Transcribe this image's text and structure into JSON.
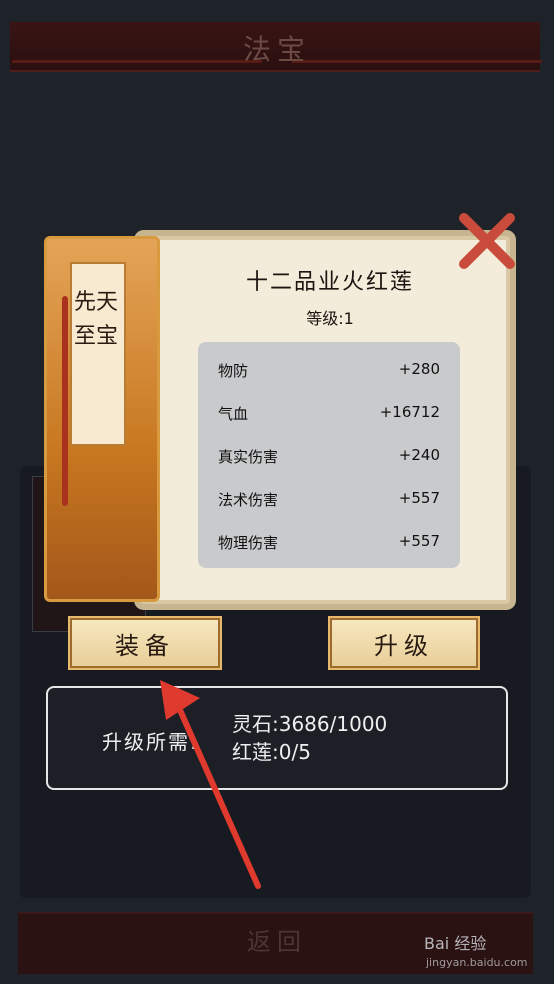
{
  "header": {
    "title": "法宝"
  },
  "footer": {
    "back_label": "返回"
  },
  "watermark": {
    "brand": "Bai 经验",
    "url": "jingyan.baidu.com"
  },
  "card": {
    "rarity_tag": "先天至宝",
    "item_name": "十二品业火红莲",
    "level_text": "等级:1",
    "stats": [
      {
        "name": "物防",
        "value": "+280"
      },
      {
        "name": "气血",
        "value": "+16712"
      },
      {
        "name": "真实伤害",
        "value": "+240"
      },
      {
        "name": "法术伤害",
        "value": "+557"
      },
      {
        "name": "物理伤害",
        "value": "+557"
      }
    ],
    "close_icon": "close-x-icon"
  },
  "buttons": {
    "equip_label": "装备",
    "upgrade_label": "升级"
  },
  "upgrade_cost": {
    "label": "升级所需:",
    "lines": [
      "灵石:3686/1000",
      "红莲:0/5"
    ]
  },
  "annotation": {
    "icon": "red-arrow-icon",
    "color": "#e03a2f"
  }
}
